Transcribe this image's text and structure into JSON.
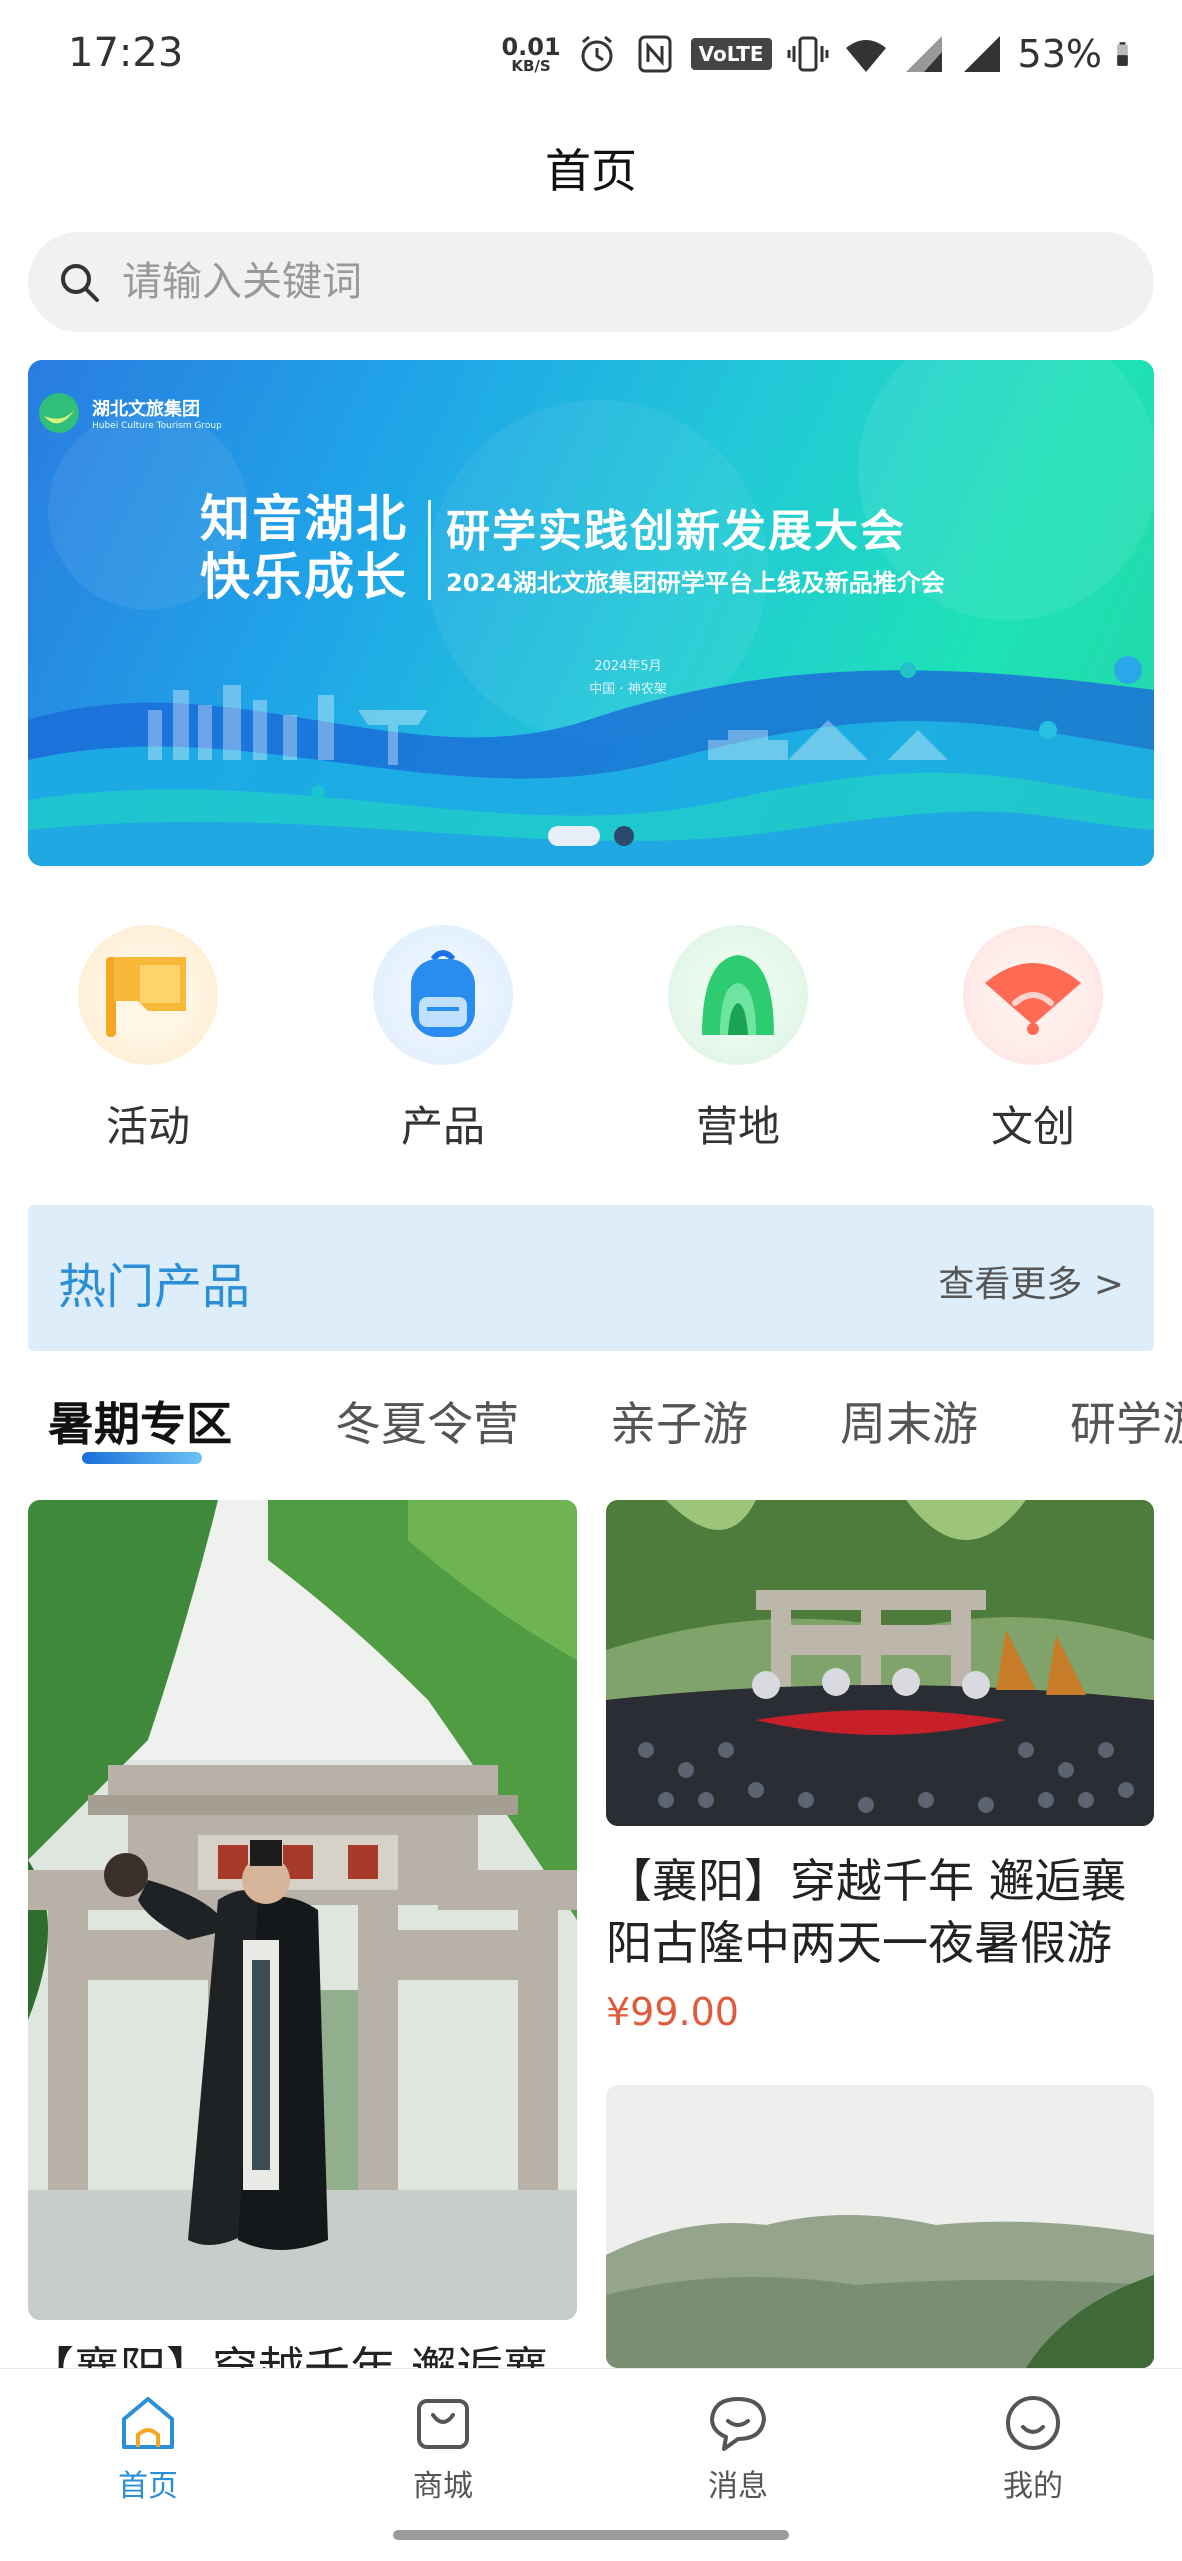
{
  "status_bar": {
    "time": "17:23",
    "net_speed_value": "0.01",
    "net_speed_unit": "KB/S",
    "volte": "VoLTE",
    "battery": "53%"
  },
  "header": {
    "title": "首页"
  },
  "search": {
    "placeholder": "请输入关键词"
  },
  "banner": {
    "logo_text": "湖北文旅集团",
    "logo_sub": "Hubei Culture Tourism Group",
    "left_line1": "知音湖北",
    "left_line2": "快乐成长",
    "title": "研学实践创新发展大会",
    "subtitle": "2024湖北文旅集团研学平台上线及新品推介会",
    "date": "2024年5月",
    "location": "中国 · 神农架",
    "slides": 2,
    "active_slide": 1
  },
  "categories": [
    {
      "label": "活动",
      "icon": "flag-icon"
    },
    {
      "label": "产品",
      "icon": "backpack-icon"
    },
    {
      "label": "营地",
      "icon": "tent-icon"
    },
    {
      "label": "文创",
      "icon": "fan-icon"
    }
  ],
  "hot_products": {
    "title": "热门产品",
    "more": "查看更多 >"
  },
  "tabs": [
    {
      "label": "暑期专区",
      "active": true
    },
    {
      "label": "冬夏令营",
      "active": false
    },
    {
      "label": "亲子游",
      "active": false
    },
    {
      "label": "周末游",
      "active": false
    },
    {
      "label": "研学游",
      "active": false
    }
  ],
  "products": [
    {
      "title": "【襄阳】穿越千年 邂逅襄",
      "image": "kongming-archway-photo"
    },
    {
      "title_line1": "【襄阳】穿越千年 邂逅襄",
      "title_line2": "阳古隆中两天一夜暑假游",
      "price": "¥99.00",
      "image": "gulongzhong-performance-photo"
    },
    {
      "image": "mountain-landscape-photo"
    }
  ],
  "bottom_nav": [
    {
      "label": "首页",
      "icon": "home-icon",
      "active": true
    },
    {
      "label": "商城",
      "icon": "shopping-bag-icon",
      "active": false
    },
    {
      "label": "消息",
      "icon": "message-icon",
      "active": false
    },
    {
      "label": "我的",
      "icon": "profile-smile-icon",
      "active": false
    }
  ],
  "colors": {
    "accent": "#2a8fd6",
    "price": "#e05a3c",
    "hot_header_bg": "#ddeefa"
  }
}
